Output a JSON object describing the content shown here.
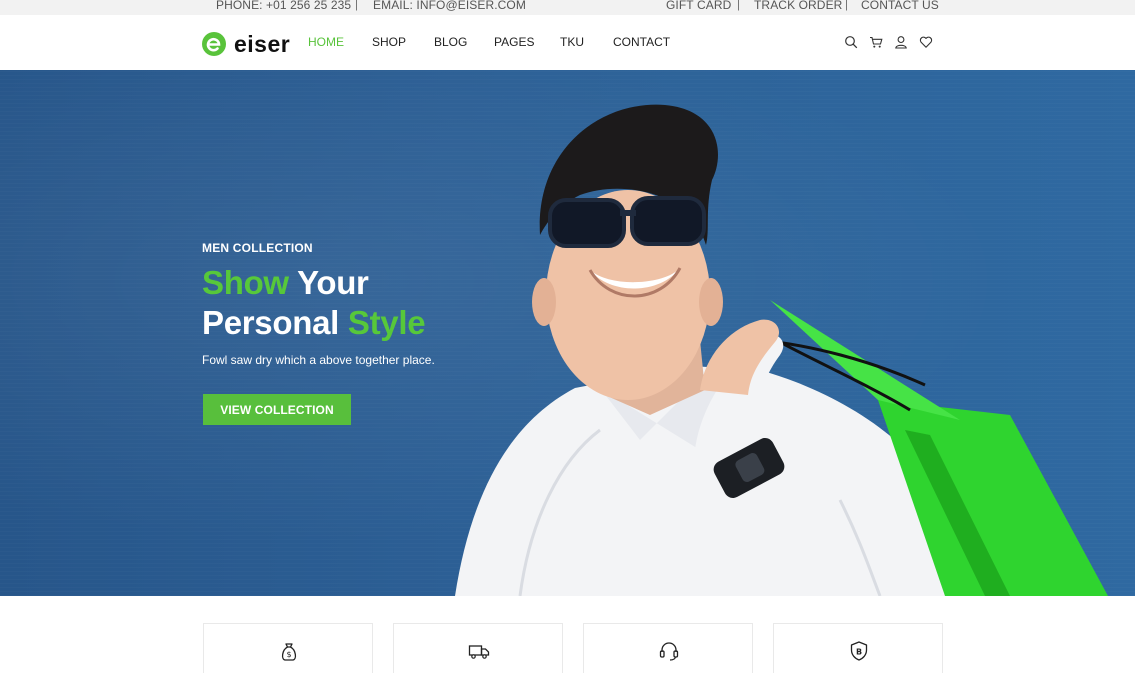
{
  "topbar": {
    "phone": "PHONE: +01 256 25 235",
    "email": "EMAIL: INFO@EISER.COM",
    "separator": "|",
    "links": [
      "GIFT CARD",
      "TRACK ORDER",
      "CONTACT US"
    ]
  },
  "brand": {
    "name": "eiser",
    "accent": "#59c33b"
  },
  "nav": {
    "items": [
      "HOME",
      "SHOP",
      "BLOG",
      "PAGES",
      "TKU",
      "CONTACT"
    ],
    "active": "HOME"
  },
  "header_icons": [
    "search-icon",
    "cart-icon",
    "user-icon",
    "heart-icon"
  ],
  "hero": {
    "eyebrow": "MEN COLLECTION",
    "headline_1_green": "Show",
    "headline_1_white": " Your",
    "headline_2_white": "Personal ",
    "headline_2_green": "Style",
    "subtitle": "Fowl saw dry which a above together place.",
    "cta_label": "VIEW COLLECTION"
  },
  "features": [
    {
      "icon": "money-bag-icon"
    },
    {
      "icon": "truck-icon"
    },
    {
      "icon": "headset-icon"
    },
    {
      "icon": "shield-icon"
    }
  ]
}
